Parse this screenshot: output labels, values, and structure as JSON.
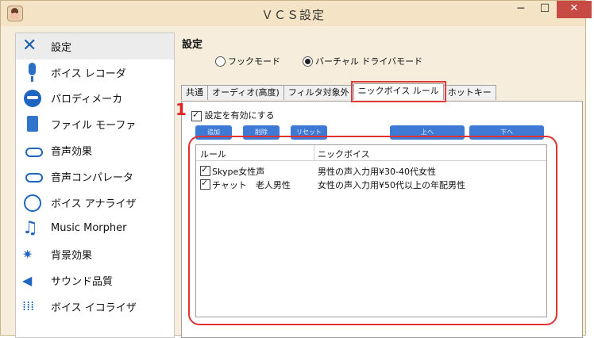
{
  "window": {
    "title": "ＶＣＳ設定",
    "min": "─",
    "max": "☐",
    "close": "✕"
  },
  "sidebar": [
    {
      "label": "設定",
      "icon": "tools-icon",
      "active": true
    },
    {
      "label": "ボイス レコーダ",
      "icon": "microphone-icon"
    },
    {
      "label": "パロディメーカ",
      "icon": "mask-icon"
    },
    {
      "label": "ファイル モーファ",
      "icon": "file-icon"
    },
    {
      "label": "音声効果",
      "icon": "lips-icon"
    },
    {
      "label": "音声コンパレータ",
      "icon": "lips-compare-icon"
    },
    {
      "label": "ボイス アナライザ",
      "icon": "analyzer-icon"
    },
    {
      "label": "Music Morpher",
      "icon": "music-note-icon"
    },
    {
      "label": "背景効果",
      "icon": "background-effect-icon"
    },
    {
      "label": "サウンド品質",
      "icon": "speaker-icon"
    },
    {
      "label": "ボイス イコライザ",
      "icon": "equalizer-icon"
    }
  ],
  "main": {
    "title": "設定",
    "radios": [
      {
        "label": "フックモード",
        "selected": false
      },
      {
        "label": "バーチャル ドライバモード",
        "selected": true
      }
    ],
    "tabs": [
      "共通",
      "オーディオ(高度)",
      "フィルタ対象外",
      "ニックボイス ルール",
      "ホットキー"
    ],
    "selected_tab": 3,
    "marker": "1",
    "enable_label": "設定を有効にする",
    "buttons": [
      "追加",
      "削除",
      "リセット",
      "上へ",
      "下へ"
    ],
    "table": {
      "headers": [
        "ルール",
        "ニックボイス"
      ],
      "rows": [
        {
          "checked": true,
          "rule": "Skype女性声",
          "voice": "男性の声入力用¥30-40代女性"
        },
        {
          "checked": true,
          "rule": "チャット　老人男性",
          "voice": "女性の声入力用¥50代以上の年配男性"
        }
      ]
    }
  },
  "colors": {
    "accent": "#3f79d6",
    "highlight": "#e03232",
    "window_bg": "#f6eddc"
  }
}
